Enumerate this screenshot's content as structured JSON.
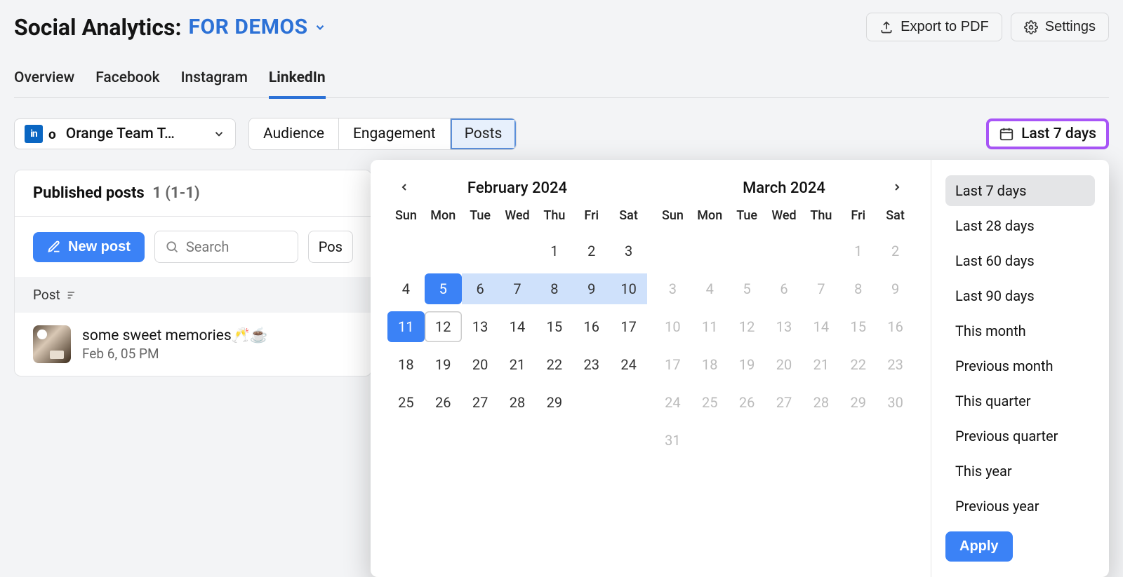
{
  "header": {
    "title_prefix": "Social Analytics:",
    "project_name": "FOR DEMOS",
    "export_label": "Export to PDF",
    "settings_label": "Settings"
  },
  "tabs": {
    "items": [
      "Overview",
      "Facebook",
      "Instagram",
      "LinkedIn"
    ],
    "active_index": 3
  },
  "account": {
    "network_icon": "linkedin",
    "extra_badge": "o",
    "name": "Orange Team T…"
  },
  "subtabs": {
    "items": [
      "Audience",
      "Engagement",
      "Posts"
    ],
    "active_index": 2
  },
  "date_range": {
    "button_label": "Last 7 days",
    "presets": [
      "Last 7 days",
      "Last 28 days",
      "Last 60 days",
      "Last 90 days",
      "This month",
      "Previous month",
      "This quarter",
      "Previous quarter",
      "This year",
      "Previous year"
    ],
    "active_preset_index": 0,
    "apply_label": "Apply",
    "calendars": {
      "left": {
        "title": "February 2024",
        "weeks": [
          [
            {
              "n": null
            },
            {
              "n": null
            },
            {
              "n": null
            },
            {
              "n": null
            },
            {
              "n": 1
            },
            {
              "n": 2
            },
            {
              "n": 3
            }
          ],
          [
            {
              "n": 4
            },
            {
              "n": 5,
              "s": "range-start"
            },
            {
              "n": 6,
              "s": "range"
            },
            {
              "n": 7,
              "s": "range"
            },
            {
              "n": 8,
              "s": "range"
            },
            {
              "n": 9,
              "s": "range"
            },
            {
              "n": 10,
              "s": "range"
            }
          ],
          [
            {
              "n": 11,
              "s": "range-end"
            },
            {
              "n": 12,
              "s": "today"
            },
            {
              "n": 13
            },
            {
              "n": 14
            },
            {
              "n": 15
            },
            {
              "n": 16
            },
            {
              "n": 17
            }
          ],
          [
            {
              "n": 18
            },
            {
              "n": 19
            },
            {
              "n": 20
            },
            {
              "n": 21
            },
            {
              "n": 22
            },
            {
              "n": 23
            },
            {
              "n": 24
            }
          ],
          [
            {
              "n": 25
            },
            {
              "n": 26
            },
            {
              "n": 27
            },
            {
              "n": 28
            },
            {
              "n": 29
            },
            {
              "n": null
            },
            {
              "n": null
            }
          ]
        ]
      },
      "right": {
        "title": "March 2024",
        "weeks": [
          [
            {
              "n": null
            },
            {
              "n": null
            },
            {
              "n": null
            },
            {
              "n": null
            },
            {
              "n": null
            },
            {
              "n": 1,
              "s": "muted"
            },
            {
              "n": 2,
              "s": "muted"
            }
          ],
          [
            {
              "n": 3,
              "s": "muted"
            },
            {
              "n": 4,
              "s": "muted"
            },
            {
              "n": 5,
              "s": "muted"
            },
            {
              "n": 6,
              "s": "muted"
            },
            {
              "n": 7,
              "s": "muted"
            },
            {
              "n": 8,
              "s": "muted"
            },
            {
              "n": 9,
              "s": "muted"
            }
          ],
          [
            {
              "n": 10,
              "s": "muted"
            },
            {
              "n": 11,
              "s": "muted"
            },
            {
              "n": 12,
              "s": "muted"
            },
            {
              "n": 13,
              "s": "muted"
            },
            {
              "n": 14,
              "s": "muted"
            },
            {
              "n": 15,
              "s": "muted"
            },
            {
              "n": 16,
              "s": "muted"
            }
          ],
          [
            {
              "n": 17,
              "s": "muted"
            },
            {
              "n": 18,
              "s": "muted"
            },
            {
              "n": 19,
              "s": "muted"
            },
            {
              "n": 20,
              "s": "muted"
            },
            {
              "n": 21,
              "s": "muted"
            },
            {
              "n": 22,
              "s": "muted"
            },
            {
              "n": 23,
              "s": "muted"
            }
          ],
          [
            {
              "n": 24,
              "s": "muted"
            },
            {
              "n": 25,
              "s": "muted"
            },
            {
              "n": 26,
              "s": "muted"
            },
            {
              "n": 27,
              "s": "muted"
            },
            {
              "n": 28,
              "s": "muted"
            },
            {
              "n": 29,
              "s": "muted"
            },
            {
              "n": 30,
              "s": "muted"
            }
          ],
          [
            {
              "n": 31,
              "s": "muted"
            },
            {
              "n": null
            },
            {
              "n": null
            },
            {
              "n": null
            },
            {
              "n": null
            },
            {
              "n": null
            },
            {
              "n": null
            }
          ]
        ]
      },
      "dow": [
        "Sun",
        "Mon",
        "Tue",
        "Wed",
        "Thu",
        "Fri",
        "Sat"
      ]
    }
  },
  "posts_card": {
    "header_label": "Published posts",
    "count_text": "1 (1-1)",
    "new_post_label": "New post",
    "search_placeholder": "Search",
    "filter_label": "Pos",
    "column_label": "Post",
    "rows": [
      {
        "title": "some sweet memories🥂☕",
        "date": "Feb 6, 05 PM"
      }
    ]
  }
}
